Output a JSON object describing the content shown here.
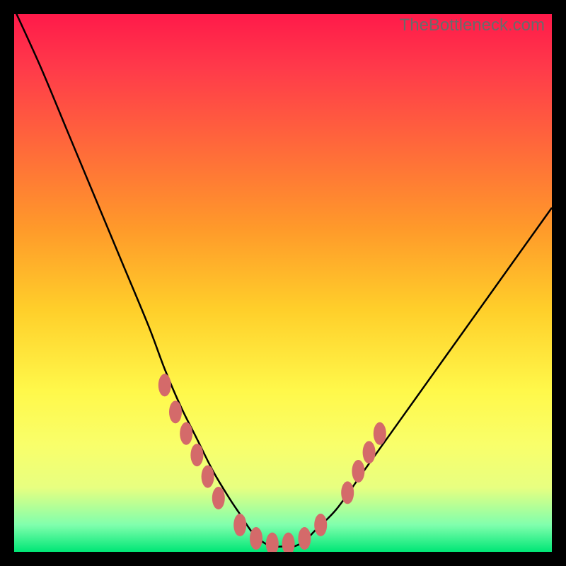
{
  "watermark": "TheBottleneck.com",
  "chart_data": {
    "type": "line",
    "title": "",
    "xlabel": "",
    "ylabel": "",
    "xlim": [
      0,
      100
    ],
    "ylim": [
      0,
      100
    ],
    "series": [
      {
        "name": "bottleneck-curve",
        "x": [
          0,
          5,
          10,
          15,
          20,
          25,
          28,
          31,
          34,
          37,
          40,
          42,
          44,
          46,
          48,
          50,
          52,
          54,
          56,
          60,
          65,
          70,
          75,
          80,
          85,
          90,
          95,
          100
        ],
        "y": [
          101,
          90,
          78,
          66,
          54,
          42,
          34,
          27,
          21,
          15,
          10,
          7,
          4,
          2,
          1,
          1,
          1,
          2,
          4,
          8,
          15,
          22,
          29,
          36,
          43,
          50,
          57,
          64
        ]
      }
    ],
    "markers": {
      "name": "highlight-dots",
      "color": "#d46a6a",
      "points": [
        {
          "x": 28,
          "y": 31
        },
        {
          "x": 30,
          "y": 26
        },
        {
          "x": 32,
          "y": 22
        },
        {
          "x": 34,
          "y": 18
        },
        {
          "x": 36,
          "y": 14
        },
        {
          "x": 38,
          "y": 10
        },
        {
          "x": 42,
          "y": 5
        },
        {
          "x": 45,
          "y": 2.5
        },
        {
          "x": 48,
          "y": 1.5
        },
        {
          "x": 51,
          "y": 1.5
        },
        {
          "x": 54,
          "y": 2.5
        },
        {
          "x": 57,
          "y": 5
        },
        {
          "x": 62,
          "y": 11
        },
        {
          "x": 64,
          "y": 15
        },
        {
          "x": 66,
          "y": 18.5
        },
        {
          "x": 68,
          "y": 22
        }
      ]
    }
  }
}
